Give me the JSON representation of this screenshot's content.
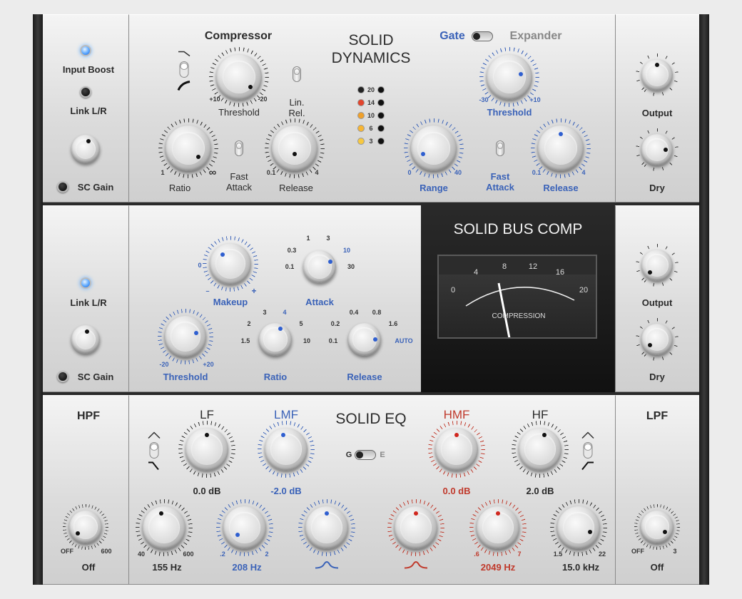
{
  "dynamics": {
    "title_line1": "SOLID",
    "title_line2": "DYNAMICS",
    "input_boost": "Input Boost",
    "link_lr": "Link L/R",
    "sc_gain": "SC Gain",
    "compressor": "Compressor",
    "threshold": "Threshold",
    "lin_rel_1": "Lin.",
    "lin_rel_2": "Rel.",
    "ratio": "Ratio",
    "fast_attack_1": "Fast",
    "fast_attack_2": "Attack",
    "release": "Release",
    "gate": "Gate",
    "expander": "Expander",
    "range": "Range",
    "output": "Output",
    "dry": "Dry",
    "comp_threshold_min": "+10",
    "comp_threshold_max": "-20",
    "ratio_min": "1",
    "ratio_max": "∞",
    "release_min": "0.1",
    "release_max": "4",
    "gate_threshold_min": "-30",
    "gate_threshold_max": "+10",
    "range_min": "0",
    "range_max": "40",
    "meter": [
      "20",
      "14",
      "10",
      "6",
      "3"
    ]
  },
  "bus": {
    "title": "SOLID BUS COMP",
    "link_lr": "Link L/R",
    "sc_gain": "SC Gain",
    "makeup": "Makeup",
    "makeup_zero": "0",
    "makeup_minus": "–",
    "makeup_plus": "+",
    "attack": "Attack",
    "attack_scale": [
      "0.3",
      "1",
      "3",
      "10",
      "0.1",
      "30"
    ],
    "threshold": "Threshold",
    "threshold_min": "-20",
    "threshold_max": "+20",
    "ratio": "Ratio",
    "ratio_scale": [
      "2",
      "3",
      "4",
      "5",
      "1.5",
      "10"
    ],
    "release": "Release",
    "release_scale": [
      "0.2",
      "0.4",
      "0.8",
      "1.6",
      "0.1",
      "AUTO"
    ],
    "output": "Output",
    "dry": "Dry",
    "vu_scale": [
      "0",
      "4",
      "8",
      "12",
      "16",
      "20"
    ],
    "vu_label": "COMPRESSION"
  },
  "eq": {
    "title": "SOLID EQ",
    "hpf": "HPF",
    "lpf": "LPF",
    "lf": "LF",
    "lmf": "LMF",
    "hmf": "HMF",
    "hf": "HF",
    "g": "G",
    "e": "E",
    "lf_gain": "0.0 dB",
    "lmf_gain": "-2.0 dB",
    "hmf_gain": "0.0 dB",
    "hf_gain": "2.0 dB",
    "hpf_off": "OFF",
    "hpf_max": "600",
    "hpf_value": "Off",
    "lpf_off": "OFF",
    "lpf_max": "3",
    "lpf_value": "Off",
    "lf_freq_min": "40",
    "lf_freq_max": "600",
    "lf_freq": "155 Hz",
    "lmf_freq_min": ".2",
    "lmf_freq_max": "2",
    "lmf_freq": "208 Hz",
    "hmf_freq_min": ".6",
    "hmf_freq_max": "7",
    "hmf_freq": "2049 Hz",
    "hf_freq_min": "1.5",
    "hf_freq_max": "22",
    "hf_freq": "15.0 kHz"
  },
  "colors": {
    "accent_blue": "#3a62b8",
    "accent_red": "#c0392b"
  }
}
